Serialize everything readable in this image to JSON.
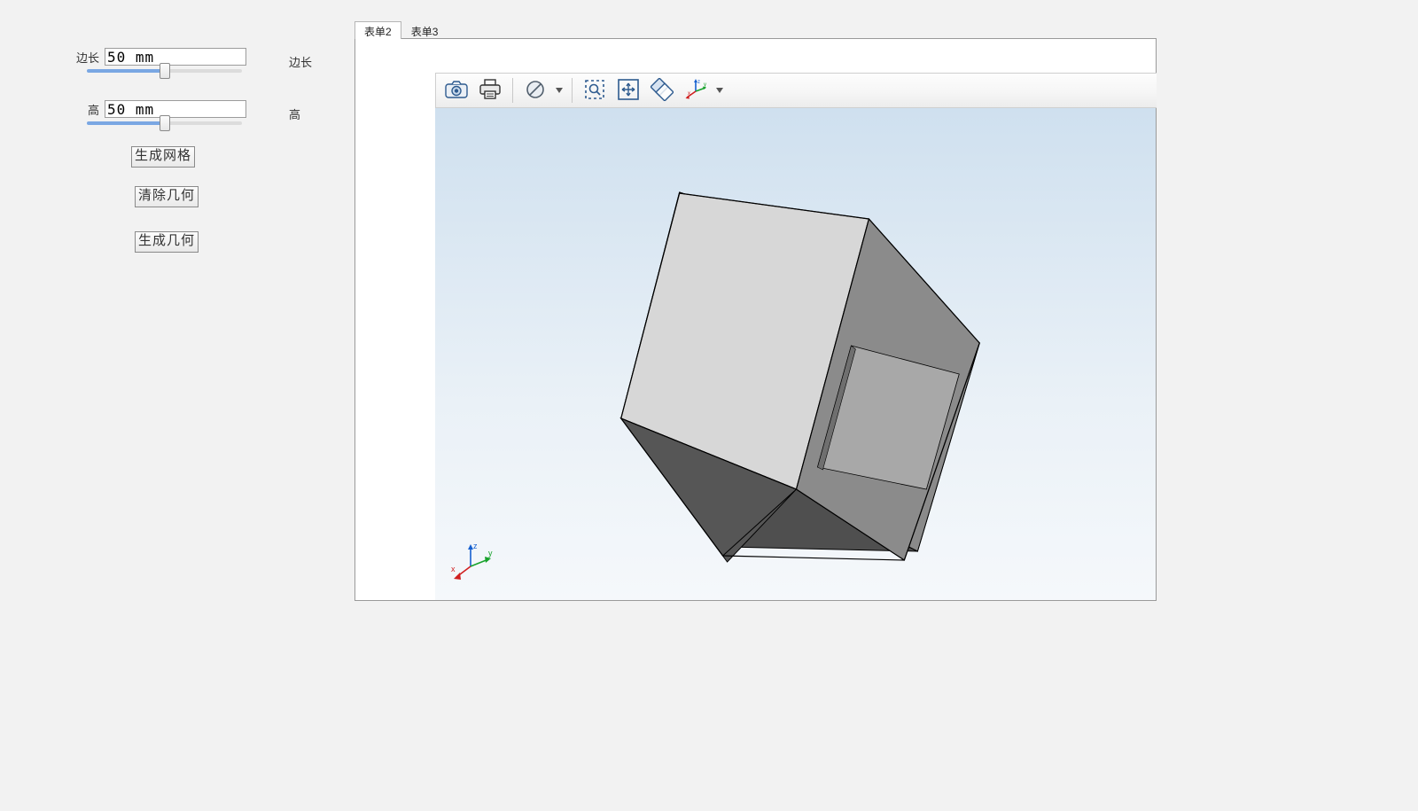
{
  "panel": {
    "param1": {
      "label_left": "边长",
      "value": "50 mm",
      "label_right": "边长"
    },
    "param2": {
      "label_left": "高",
      "value": "50 mm",
      "label_right": "高"
    },
    "btn_mesh": "生成网格",
    "btn_clear": "清除几何",
    "btn_build": "生成几何"
  },
  "tabs": {
    "t1": "表单2",
    "t2": "表单3"
  },
  "triad": {
    "x": "x",
    "y": "y",
    "z": "z"
  }
}
